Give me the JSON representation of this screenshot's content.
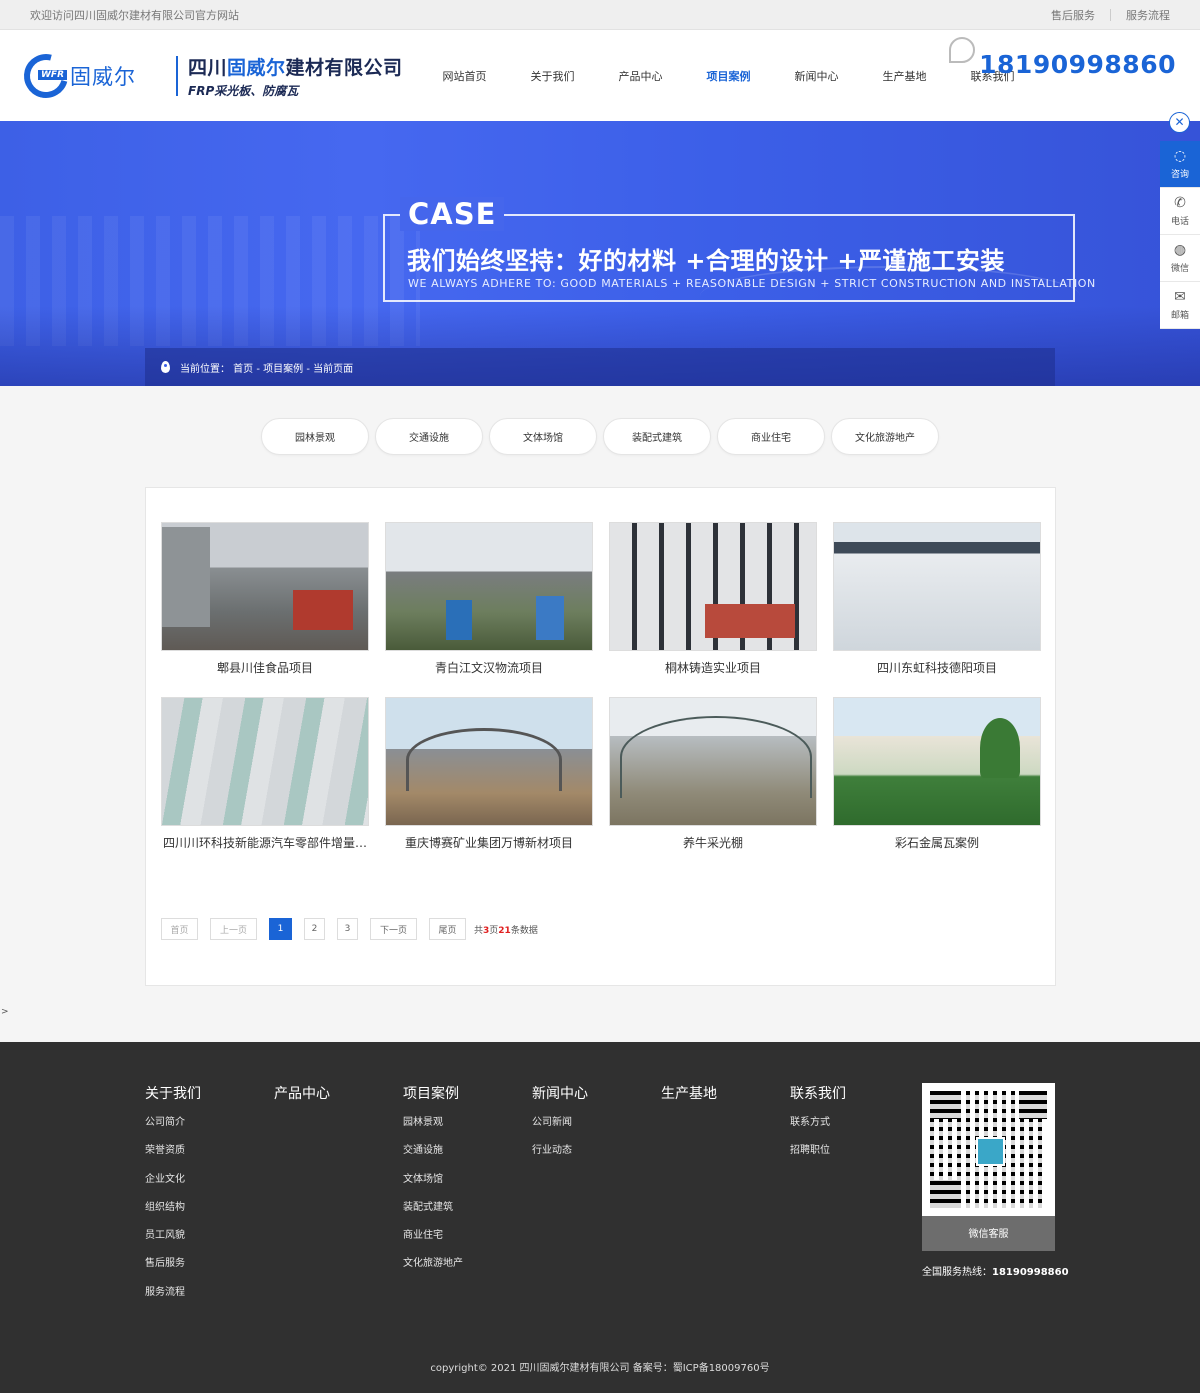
{
  "topbar": {
    "welcome": "欢迎访问四川固威尔建材有限公司官方网站",
    "links": [
      "售后服务",
      "服务流程"
    ]
  },
  "header": {
    "logo_tag": "WFR",
    "logo_text": "固威尔",
    "company_prefix": "四川",
    "company_highlight": "固威尔",
    "company_suffix": "建材有限公司",
    "company_sub": "FRP采光板、防腐瓦",
    "phone": "18190998860"
  },
  "nav": {
    "items": [
      "网站首页",
      "关于我们",
      "产品中心",
      "项目案例",
      "新闻中心",
      "生产基地",
      "联系我们"
    ],
    "active": "项目案例"
  },
  "banner": {
    "title": "CASE",
    "slogan": "我们始终坚持：好的材料 +合理的设计 +严谨施工安装",
    "slogan_en": "WE ALWAYS ADHERE TO: GOOD MATERIALS + REASONABLE DESIGN + STRICT CONSTRUCTION AND INSTALLATION",
    "breadcrumb": "当前位置：  首页 - 项目案例 - 当前页面"
  },
  "side": {
    "close": "✕",
    "items": [
      {
        "icon": "qq-icon",
        "label": "咨询"
      },
      {
        "icon": "phone-icon",
        "label": "电话"
      },
      {
        "icon": "wechat-icon",
        "label": "微信"
      },
      {
        "icon": "mail-icon",
        "label": "邮箱"
      }
    ]
  },
  "categories": [
    "园林景观",
    "交通设施",
    "文体场馆",
    "装配式建筑",
    "商业住宅",
    "文化旅游地产"
  ],
  "cases": [
    "郫县川佳食品项目",
    "青白江文汉物流项目",
    "桐林铸造实业项目",
    "四川东虹科技德阳项目",
    "四川川环科技新能源汽车零部件增量…",
    "重庆博赛矿业集团万博新材项目",
    "养牛采光棚",
    "彩石金属瓦案例"
  ],
  "pager": {
    "first": "首页",
    "prev": "上一页",
    "pages": [
      "1",
      "2",
      "3"
    ],
    "current": "1",
    "next": "下一页",
    "last": "尾页",
    "info_prefix": "共",
    "total_pages": "3",
    "info_mid": "页",
    "total_items": "21",
    "info_suffix": "条数据"
  },
  "stray": ">",
  "footer": {
    "columns": [
      {
        "title": "关于我们",
        "links": [
          "公司简介",
          "荣誉资质",
          "企业文化",
          "组织结构",
          "员工风貌",
          "售后服务",
          "服务流程"
        ]
      },
      {
        "title": "产品中心",
        "links": []
      },
      {
        "title": "项目案例",
        "links": [
          "园林景观",
          "交通设施",
          "文体场馆",
          "装配式建筑",
          "商业住宅",
          "文化旅游地产"
        ]
      },
      {
        "title": "新闻中心",
        "links": [
          "公司新闻",
          "行业动态"
        ]
      },
      {
        "title": "生产基地",
        "links": []
      },
      {
        "title": "联系我们",
        "links": [
          "联系方式",
          "招聘职位"
        ]
      }
    ],
    "qr_label": "微信客服",
    "hotline_label": "全国服务热线：",
    "hotline": "18190998860",
    "copyright": "copyright© 2021 四川固威尔建材有限公司   备案号：蜀ICP备18009760号"
  }
}
